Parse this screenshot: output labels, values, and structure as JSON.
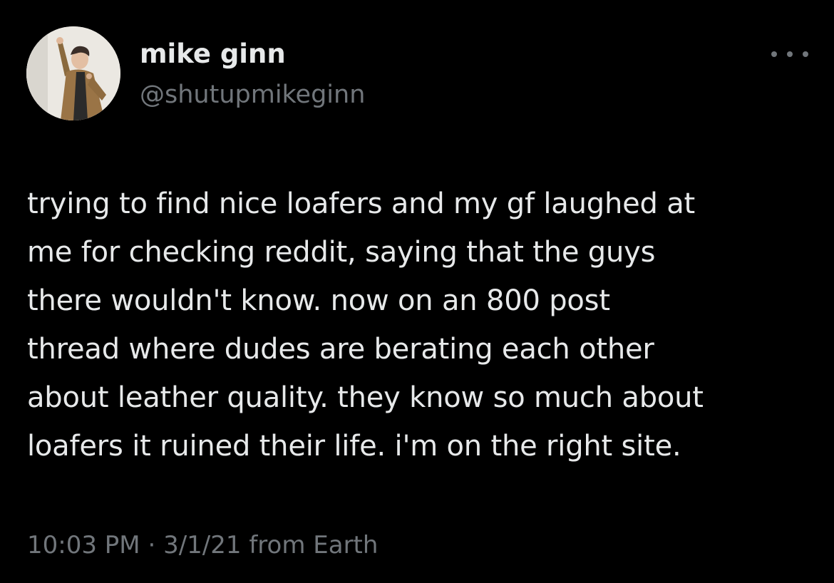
{
  "author": {
    "display_name": "mike ginn",
    "handle": "@shutupmikeginn",
    "avatar_icon": "profile-photo"
  },
  "more_icon": "more-options-icon",
  "tweet": {
    "text": "trying to find nice loafers and my gf laughed at\nme for checking reddit, saying that the guys\nthere wouldn't know. now on an 800 post\nthread where dudes are berating each other\nabout leather quality. they know so much about\nloafers it ruined their life. i'm on the right site."
  },
  "meta": {
    "time": "10:03 PM",
    "separator": " · ",
    "date": "3/1/21",
    "source": " from Earth"
  },
  "colors": {
    "background": "#000000",
    "primary_text": "#e7e9ea",
    "secondary_text": "#71767b"
  }
}
